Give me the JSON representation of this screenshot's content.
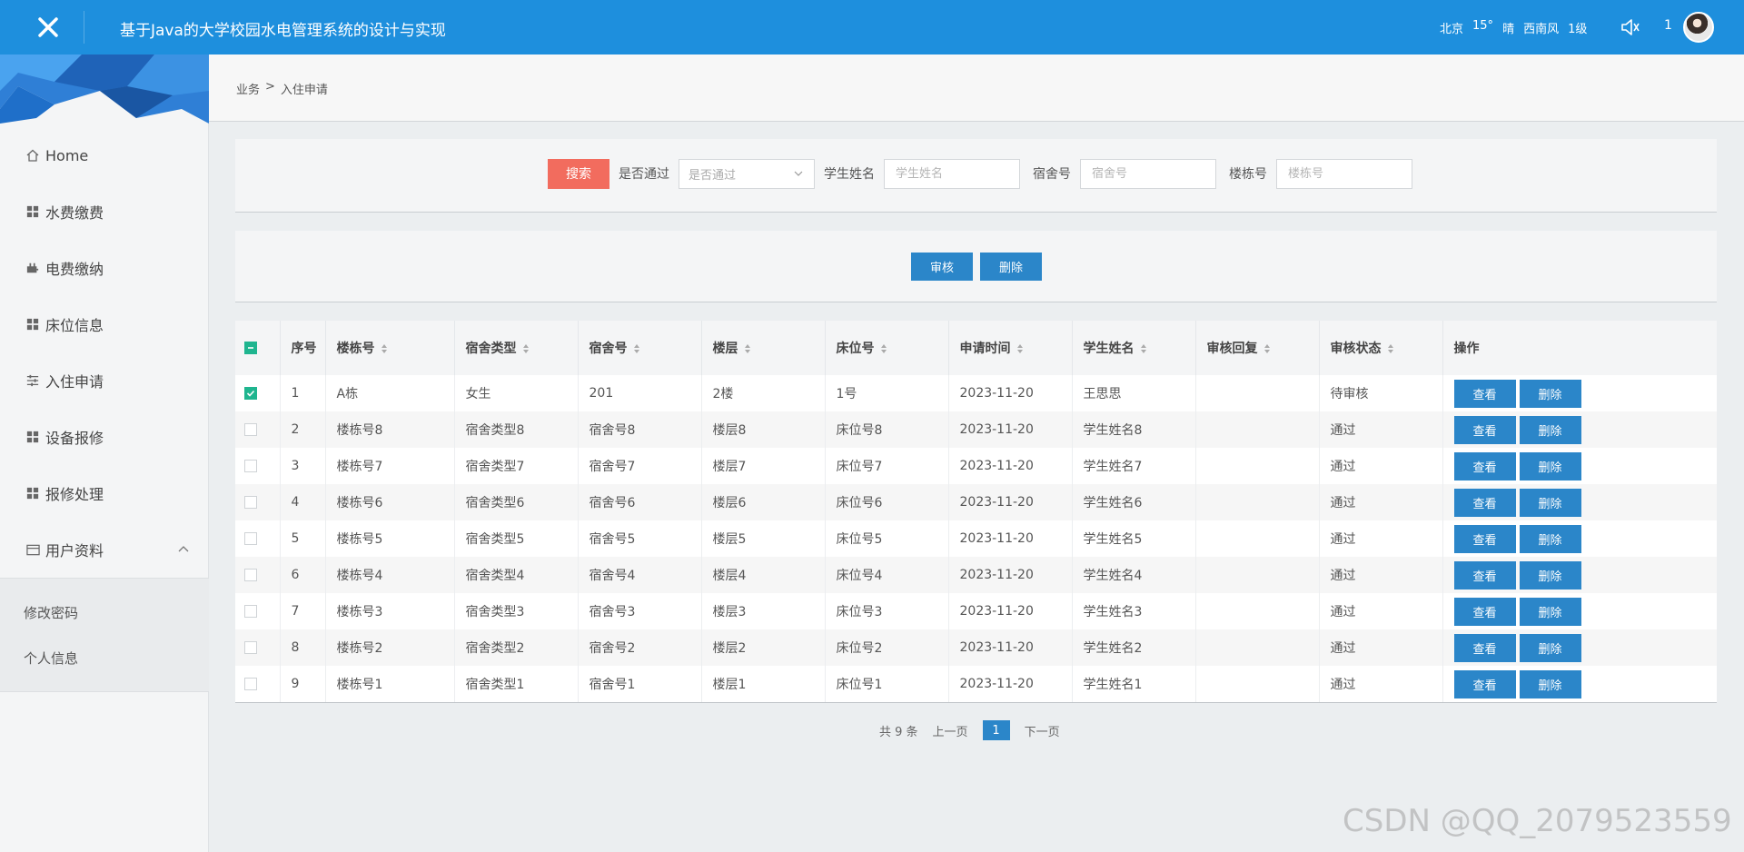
{
  "header": {
    "title": "基于Java的大学校园水电管理系统的设计与实现",
    "weather": {
      "city": "北京",
      "temp": "15°",
      "condition": "晴",
      "wind": "西南风",
      "level": "1级"
    },
    "notice_count": "1"
  },
  "sidebar": {
    "items": [
      {
        "label": "Home",
        "icon": "home-icon"
      },
      {
        "label": "水费缴费",
        "icon": "grid-icon"
      },
      {
        "label": "电费缴纳",
        "icon": "plug-icon"
      },
      {
        "label": "床位信息",
        "icon": "grid-icon"
      },
      {
        "label": "入住申请",
        "icon": "sliders-icon"
      },
      {
        "label": "设备报修",
        "icon": "grid-icon"
      },
      {
        "label": "报修处理",
        "icon": "grid-icon"
      },
      {
        "label": "用户资料",
        "icon": "card-icon"
      }
    ],
    "submenu": [
      {
        "label": "修改密码"
      },
      {
        "label": "个人信息"
      }
    ]
  },
  "breadcrumb": {
    "parent": "业务",
    "separator": ">",
    "current": "入住申请"
  },
  "search": {
    "button": "搜索",
    "passed_label": "是否通过",
    "passed_placeholder": "是否通过",
    "student_label": "学生姓名",
    "student_placeholder": "学生姓名",
    "room_label": "宿舍号",
    "room_placeholder": "宿舍号",
    "building_label": "楼栋号",
    "building_placeholder": "楼栋号"
  },
  "actions": {
    "audit": "审核",
    "delete": "删除"
  },
  "table": {
    "headers": [
      "序号",
      "楼栋号",
      "宿舍类型",
      "宿舍号",
      "楼层",
      "床位号",
      "申请时间",
      "学生姓名",
      "审核回复",
      "审核状态",
      "操作"
    ],
    "view_label": "查看",
    "delete_label": "删除",
    "rows": [
      {
        "checked": true,
        "no": "1",
        "building": "A栋",
        "type": "女生",
        "room": "201",
        "floor": "2楼",
        "bed": "1号",
        "time": "2023-11-20",
        "student": "王思思",
        "reply": "",
        "status": "待审核"
      },
      {
        "checked": false,
        "no": "2",
        "building": "楼栋号8",
        "type": "宿舍类型8",
        "room": "宿舍号8",
        "floor": "楼层8",
        "bed": "床位号8",
        "time": "2023-11-20",
        "student": "学生姓名8",
        "reply": "",
        "status": "通过"
      },
      {
        "checked": false,
        "no": "3",
        "building": "楼栋号7",
        "type": "宿舍类型7",
        "room": "宿舍号7",
        "floor": "楼层7",
        "bed": "床位号7",
        "time": "2023-11-20",
        "student": "学生姓名7",
        "reply": "",
        "status": "通过"
      },
      {
        "checked": false,
        "no": "4",
        "building": "楼栋号6",
        "type": "宿舍类型6",
        "room": "宿舍号6",
        "floor": "楼层6",
        "bed": "床位号6",
        "time": "2023-11-20",
        "student": "学生姓名6",
        "reply": "",
        "status": "通过"
      },
      {
        "checked": false,
        "no": "5",
        "building": "楼栋号5",
        "type": "宿舍类型5",
        "room": "宿舍号5",
        "floor": "楼层5",
        "bed": "床位号5",
        "time": "2023-11-20",
        "student": "学生姓名5",
        "reply": "",
        "status": "通过"
      },
      {
        "checked": false,
        "no": "6",
        "building": "楼栋号4",
        "type": "宿舍类型4",
        "room": "宿舍号4",
        "floor": "楼层4",
        "bed": "床位号4",
        "time": "2023-11-20",
        "student": "学生姓名4",
        "reply": "",
        "status": "通过"
      },
      {
        "checked": false,
        "no": "7",
        "building": "楼栋号3",
        "type": "宿舍类型3",
        "room": "宿舍号3",
        "floor": "楼层3",
        "bed": "床位号3",
        "time": "2023-11-20",
        "student": "学生姓名3",
        "reply": "",
        "status": "通过"
      },
      {
        "checked": false,
        "no": "8",
        "building": "楼栋号2",
        "type": "宿舍类型2",
        "room": "宿舍号2",
        "floor": "楼层2",
        "bed": "床位号2",
        "time": "2023-11-20",
        "student": "学生姓名2",
        "reply": "",
        "status": "通过"
      },
      {
        "checked": false,
        "no": "9",
        "building": "楼栋号1",
        "type": "宿舍类型1",
        "room": "宿舍号1",
        "floor": "楼层1",
        "bed": "床位号1",
        "time": "2023-11-20",
        "student": "学生姓名1",
        "reply": "",
        "status": "通过"
      }
    ]
  },
  "pagination": {
    "total": "共 9 条",
    "prev": "上一页",
    "current": "1",
    "next": "下一页"
  },
  "watermark": "CSDN @QQ_2079523559",
  "colors": {
    "header": "#1e8fdd",
    "primary": "#2b86c9",
    "search": "#f26c5e",
    "checkbox": "#1fb58f"
  }
}
